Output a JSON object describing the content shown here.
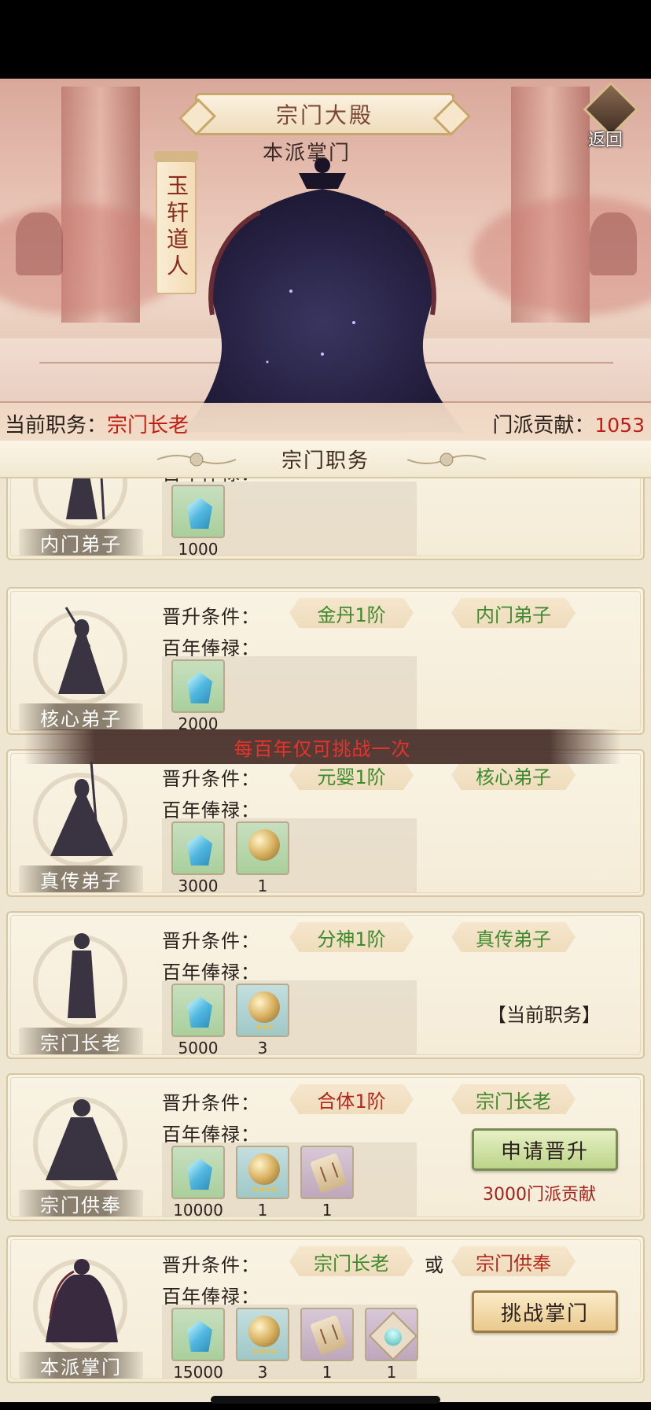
{
  "hall": {
    "title": "宗门大殿",
    "leader_title": "本派掌门",
    "leader_name": "玉轩道人",
    "back_label": "返回"
  },
  "status": {
    "role_label": "当前职务：",
    "role_value": "宗门长老",
    "contrib_label": "门派贡献：",
    "contrib_value": "1053"
  },
  "section_title": "宗门职务",
  "labels": {
    "promote": "晋升条件：",
    "salary": "百年俸禄：",
    "or": "或"
  },
  "challenge_notice": "每百年仅可挑战一次",
  "ranks": [
    {
      "name": "内门弟子",
      "rewards": [
        {
          "icon": "spirit-crystal-icon",
          "count": "1000"
        }
      ]
    },
    {
      "name": "核心弟子",
      "requirements": [
        "金丹1阶",
        "内门弟子"
      ],
      "rewards": [
        {
          "icon": "spirit-crystal-icon",
          "count": "2000"
        }
      ]
    },
    {
      "name": "真传弟子",
      "requirements": [
        "元婴1阶",
        "核心弟子"
      ],
      "rewards": [
        {
          "icon": "spirit-crystal-icon",
          "count": "3000"
        },
        {
          "icon": "gold-orb-icon",
          "count": "1"
        }
      ]
    },
    {
      "name": "宗门长老",
      "requirements": [
        "分神1阶",
        "真传弟子"
      ],
      "rewards": [
        {
          "icon": "spirit-crystal-icon",
          "count": "5000"
        },
        {
          "icon": "gold-orb-icon",
          "count": "3"
        }
      ],
      "current_tag": "【当前职务】"
    },
    {
      "name": "宗门供奉",
      "requirements": [
        "合体1阶",
        "宗门长老"
      ],
      "requirement_colors": [
        "#b4271c",
        "#3d8a2e"
      ],
      "rewards": [
        {
          "icon": "spirit-crystal-icon",
          "count": "10000"
        },
        {
          "icon": "gold-orb-icon",
          "count": "1"
        },
        {
          "icon": "scroll-icon",
          "count": "1"
        }
      ],
      "action_label": "申请晋升",
      "cost": "3000门派贡献"
    },
    {
      "name": "本派掌门",
      "requirements": [
        "宗门长老",
        "宗门供奉"
      ],
      "requirement_colors": [
        "#3d8a2e",
        "#b4271c"
      ],
      "rewards": [
        {
          "icon": "spirit-crystal-icon",
          "count": "15000"
        },
        {
          "icon": "gold-orb-icon",
          "count": "3"
        },
        {
          "icon": "scroll-icon",
          "count": "1"
        },
        {
          "icon": "jade-plate-icon",
          "count": "1"
        }
      ],
      "action_label": "挑战掌门"
    }
  ],
  "colors": {
    "accent_red": "#c01e14",
    "met_green": "#3d8a2e",
    "unmet_red": "#b4271c"
  }
}
